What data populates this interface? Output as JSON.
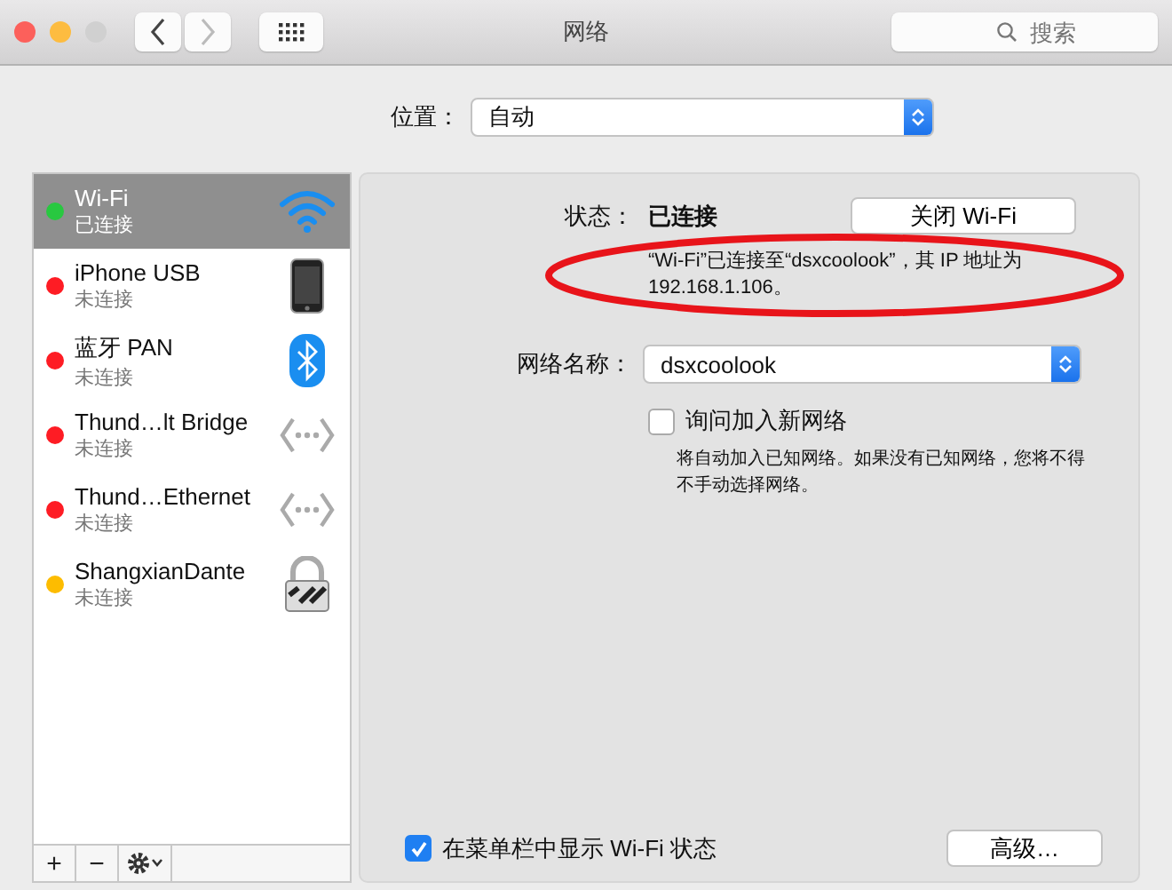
{
  "window": {
    "title": "网络",
    "search_placeholder": "搜索"
  },
  "location": {
    "label": "位置：",
    "value": "自动"
  },
  "services": [
    {
      "name": "Wi-Fi",
      "status": "已连接",
      "color": "#28c840",
      "selected": true,
      "kind": "wifi"
    },
    {
      "name": "iPhone USB",
      "status": "未连接",
      "color": "#fe1c24",
      "selected": false,
      "kind": "phone"
    },
    {
      "name": "蓝牙 PAN",
      "status": "未连接",
      "color": "#fe1c24",
      "selected": false,
      "kind": "bluetooth"
    },
    {
      "name": "Thund…lt Bridge",
      "status": "未连接",
      "color": "#fe1c24",
      "selected": false,
      "kind": "ports"
    },
    {
      "name": "Thund…Ethernet",
      "status": "未连接",
      "color": "#fe1c24",
      "selected": false,
      "kind": "ports"
    },
    {
      "name": "ShangxianDante",
      "status": "未连接",
      "color": "#fdbc00",
      "selected": false,
      "kind": "lock"
    }
  ],
  "sidebar_toolbar": [
    "+",
    "−"
  ],
  "detail": {
    "status_label": "状态：",
    "status_value": "已连接",
    "toggle_button": "关闭 Wi-Fi",
    "status_text": "“Wi-Fi”已连接至“dsxcoolook”，其 IP 地址为 192.168.1.106。",
    "network_label": "网络名称：",
    "network_value": "dsxcoolook",
    "ask_join": {
      "label": "询问加入新网络",
      "checked": false
    },
    "ask_join_hint": "将自动加入已知网络。如果没有已知网络，您将不得不手动选择网络。",
    "show_in_menu": {
      "label": "在菜单栏中显示 Wi-Fi 状态",
      "checked": true
    },
    "advanced_button": "高级…"
  },
  "annotation": {
    "kind": "ellipse"
  }
}
